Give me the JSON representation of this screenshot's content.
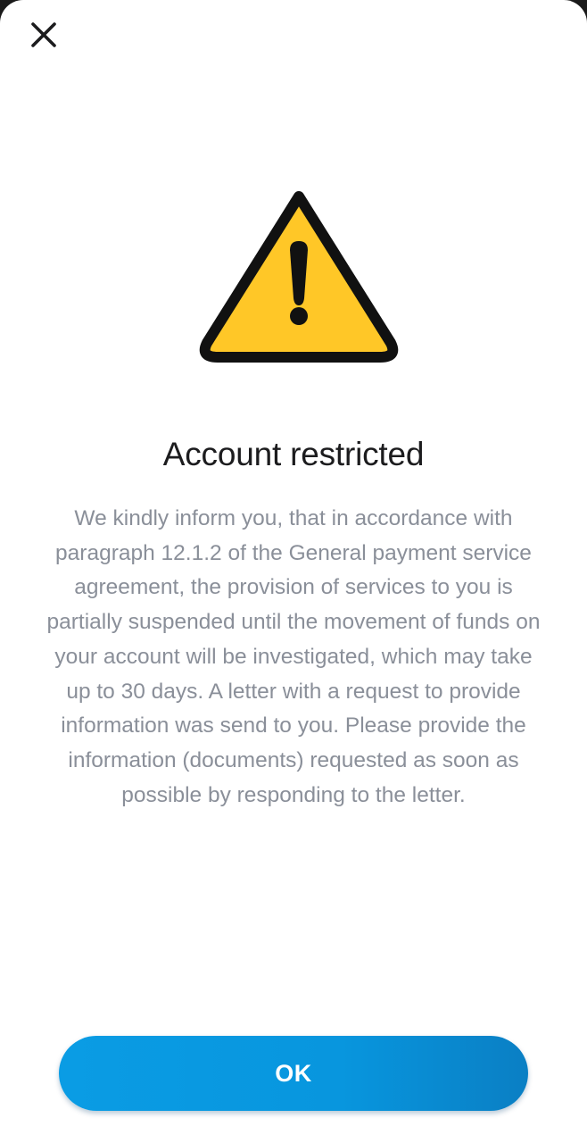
{
  "header": {
    "close_icon": "close-icon"
  },
  "alert": {
    "icon": "warning-triangle-icon",
    "title": "Account restricted",
    "message": "We kindly inform you, that in accordance with paragraph 12.1.2 of the General payment service agreement, the provision of services to you is partially suspended until the movement of funds on your account will be investigated, which may take up to 30 days. A letter with a request to provide information was send to you. Please provide the information (documents) requested as soon as possible by responding to the letter."
  },
  "footer": {
    "ok_label": "OK"
  },
  "colors": {
    "warning_fill": "#FFC727",
    "warning_stroke": "#111111",
    "button_primary": "#0A9CE4",
    "title_text": "#1C1C1E",
    "body_text": "#8A8F99"
  }
}
